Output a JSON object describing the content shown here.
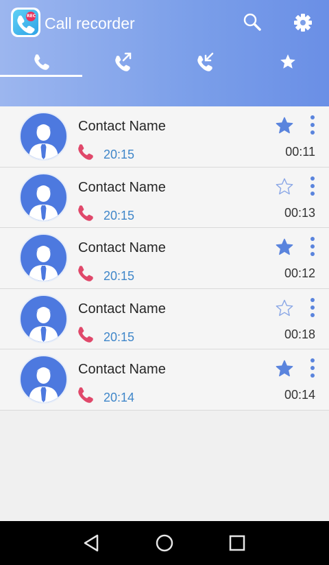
{
  "app": {
    "title": "Call recorder",
    "logo_badge": "REC"
  },
  "colors": {
    "header_start": "#9cb6ef",
    "header_end": "#6a8fe6",
    "avatar_bg": "#4d79df",
    "star_color": "#5a84dd",
    "call_icon_color": "#e0486a",
    "time_color": "#3f86c9"
  },
  "toolbar": {
    "search_icon": "search-icon",
    "settings_icon": "gear-icon"
  },
  "tabs": [
    {
      "icon": "phone-icon",
      "name": "all-calls",
      "selected": true
    },
    {
      "icon": "outgoing-call-icon",
      "name": "outgoing-calls",
      "selected": false
    },
    {
      "icon": "incoming-call-icon",
      "name": "incoming-calls",
      "selected": false
    },
    {
      "icon": "star-icon",
      "name": "favorites",
      "selected": false
    }
  ],
  "calls": [
    {
      "name": "Contact Name",
      "time": "20:15",
      "duration": "00:11",
      "starred": true
    },
    {
      "name": "Contact Name",
      "time": "20:15",
      "duration": "00:13",
      "starred": false
    },
    {
      "name": "Contact Name",
      "time": "20:15",
      "duration": "00:12",
      "starred": true
    },
    {
      "name": "Contact Name",
      "time": "20:15",
      "duration": "00:18",
      "starred": false
    },
    {
      "name": "Contact Name",
      "time": "20:14",
      "duration": "00:14",
      "starred": true
    }
  ],
  "navbar": {
    "back_icon": "back-triangle-icon",
    "home_icon": "home-circle-icon",
    "recents_icon": "recents-square-icon"
  }
}
